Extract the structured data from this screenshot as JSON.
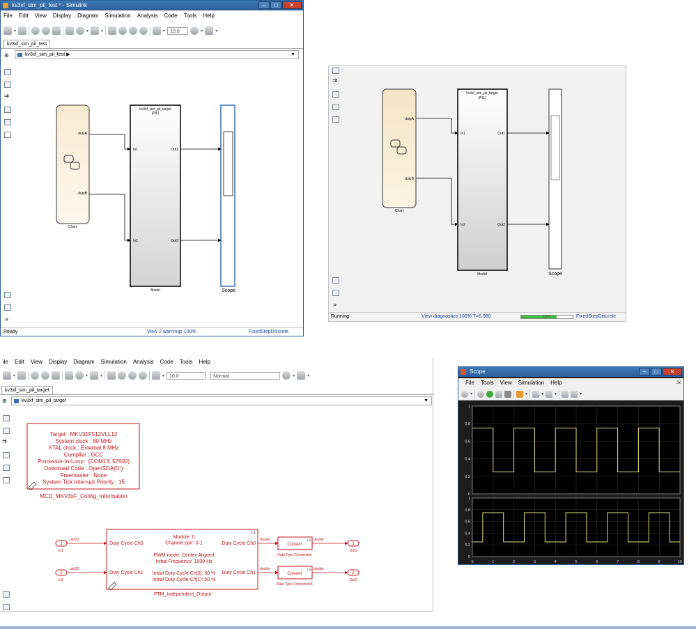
{
  "win1": {
    "title": "kv3xf_sim_pil_test * - Simulink",
    "menu": [
      "File",
      "Edit",
      "View",
      "Display",
      "Diagram",
      "Simulation",
      "Analysis",
      "Code",
      "Tools",
      "Help"
    ],
    "stop_time": "10.0",
    "tab": "kv3xf_sim_pil_test",
    "breadcrumb": "kv3xf_sim_pil_test",
    "chart": {
      "port_a": "dutyA",
      "port_b": "dutyB",
      "name": "Chart"
    },
    "model": {
      "title": "kv3xf_sim_pil_target",
      "mode": "(PIL)",
      "in1": "In1",
      "in2": "In2",
      "out1": "Out1",
      "out2": "Out2",
      "name": "Model"
    },
    "scope": {
      "name": "Scope"
    },
    "status": {
      "left": "Ready",
      "center": "View 2 warnings  100%",
      "right": "FixedStepDiscrete"
    }
  },
  "win2": {
    "chart": {
      "port_a": "dutyA",
      "port_b": "dutyB",
      "name": "Chart"
    },
    "model": {
      "title": "kv3xf_sim_pil_target",
      "mode": "(PIL)",
      "in1": "In1",
      "in2": "In2",
      "out1": "Out1",
      "out2": "Out2",
      "name": "Model"
    },
    "scope": {
      "name": "Scope"
    },
    "status": {
      "left": "Running",
      "center": "View diagnostics  100%  T=6.980",
      "progress_label": "69%",
      "progress": 0.69,
      "right": "FixedStepDiscrete"
    }
  },
  "win3": {
    "menu": [
      "ile",
      "Edit",
      "View",
      "Display",
      "Diagram",
      "Simulation",
      "Analysis",
      "Code",
      "Tools",
      "Help"
    ],
    "stop_time": "10.0",
    "sim_mode": "Normal",
    "tab": "kv3xf_sim_pil_target",
    "breadcrumb": "kv3xf_sim_pil_target",
    "config": {
      "lines": [
        "Target : MKV31F512VLL12",
        "System clock : 80 MHz",
        "XTAL clock : External 8 MHz",
        "Compiler : GCC",
        "Processor-In-Loop : (COM13, 57600)",
        "Download Code : OpenSDA(D:)",
        "Freemaster : None",
        "System Tick Interrupt Priority : 15"
      ],
      "name": "MCD_MKV3xF_Config_Information"
    },
    "ftm": {
      "badge": "1:1",
      "in_ch0": "Duty Cycle Ch0",
      "in_ch1": "Duty Cycle Ch1",
      "out_ch0": "Duty Cycle Ch0",
      "out_ch1": "Duty Cycle Ch1",
      "lines": [
        "Module: 0",
        "Channel pair: 0-1",
        "",
        "PWM mode: Center-Aligned",
        "Initial Frequency: 1000 Hz",
        "",
        "Initial Duty Cycle Ch[0]: 50 %",
        "Initial Duty Cycle Ch[1]: 50 %"
      ],
      "name": "FTM_Independent_Output"
    },
    "inport1": {
      "num": "1",
      "name": "In1",
      "sig": "uint32"
    },
    "inport2": {
      "num": "2",
      "name": "In2",
      "sig": "uint32"
    },
    "conv1": {
      "label": "Convert",
      "badge": "1:3",
      "name": "Data Type Conversion",
      "in_sig": "double",
      "out_sig": "double"
    },
    "conv2": {
      "label": "Convert",
      "badge": "1:3",
      "name": "Data Type Conversion1",
      "in_sig": "double",
      "out_sig": "double"
    },
    "outport1": {
      "num": "1",
      "name": "Out1"
    },
    "outport2": {
      "num": "2",
      "name": "Out2"
    }
  },
  "win4": {
    "title": "Scope",
    "menu": [
      "File",
      "Tools",
      "View",
      "Simulation",
      "Help"
    ],
    "y_ticks": [
      "1",
      "0.8",
      "0.6",
      "0.4",
      "0.2",
      "0"
    ],
    "x_ticks": [
      "0",
      "1",
      "2",
      "3",
      "4",
      "5",
      "6",
      "7",
      "8",
      "9",
      "10"
    ]
  },
  "chart_data": {
    "type": "line",
    "x_range": [
      0,
      10
    ],
    "y_range": [
      0,
      1
    ],
    "grid": true,
    "panels": [
      {
        "x": [
          0,
          1,
          1,
          2,
          2,
          3,
          3,
          4,
          4,
          5,
          5,
          6,
          6,
          7,
          7,
          8,
          8,
          9,
          9,
          10
        ],
        "y": [
          0.75,
          0.75,
          0.25,
          0.25,
          0.75,
          0.75,
          0.25,
          0.25,
          0.75,
          0.75,
          0.25,
          0.25,
          0.75,
          0.75,
          0.25,
          0.25,
          0.75,
          0.75,
          0.25,
          0.25
        ]
      },
      {
        "x": [
          0,
          0.5,
          0.5,
          1.5,
          1.5,
          2.5,
          2.5,
          3.5,
          3.5,
          4.5,
          4.5,
          5.5,
          5.5,
          6.5,
          6.5,
          7.5,
          7.5,
          8.5,
          8.5,
          9.5,
          9.5,
          10
        ],
        "y": [
          0.25,
          0.25,
          0.75,
          0.75,
          0.25,
          0.25,
          0.75,
          0.75,
          0.25,
          0.25,
          0.75,
          0.75,
          0.25,
          0.25,
          0.75,
          0.75,
          0.25,
          0.25,
          0.75,
          0.75,
          0.25,
          0.25
        ]
      }
    ],
    "colors": {
      "background": "#000000",
      "grid": "#3a3a3a",
      "line": "#e8e37a",
      "frame": "#c8c8c8"
    }
  }
}
